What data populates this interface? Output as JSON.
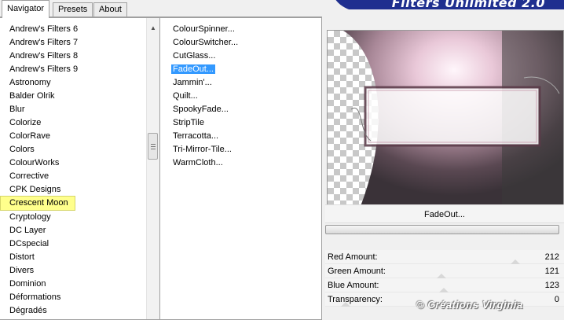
{
  "banner": {
    "text": "Filters Unlimited 2.0"
  },
  "tabs": [
    {
      "label": "Navigator"
    },
    {
      "label": "Presets"
    },
    {
      "label": "About"
    }
  ],
  "categories": {
    "items": [
      "Andrew's Filters 6",
      "Andrew's Filters 7",
      "Andrew's Filters 8",
      "Andrew's Filters 9",
      "Astronomy",
      "Balder Olrik",
      "Blur",
      "Colorize",
      "ColorRave",
      "Colors",
      "ColourWorks",
      "Corrective",
      "CPK Designs",
      "Crescent Moon",
      "Cryptology",
      "DC Layer",
      "DCspecial",
      "Distort",
      "Divers",
      "Dominion",
      "Déformations",
      "Dégradés"
    ],
    "highlighted": "Crescent Moon"
  },
  "filters": {
    "items": [
      "ColourSpinner...",
      "ColourSwitcher...",
      "CutGlass...",
      "FadeOut...",
      "Jammin'...",
      "Quilt...",
      "SpookyFade...",
      "StripTile",
      "Terracotta...",
      "Tri-Mirror-Tile...",
      "WarmCloth..."
    ],
    "selected": "FadeOut..."
  },
  "preview": {
    "filter_name": "FadeOut..."
  },
  "params": [
    {
      "label": "Red Amount:",
      "value": "212",
      "level": 0.83
    },
    {
      "label": "Green Amount:",
      "value": "121",
      "level": 0.47
    },
    {
      "label": "Blue Amount:",
      "value": "123",
      "level": 0.48
    },
    {
      "label": "Transparency:",
      "value": "0",
      "level": 0.0
    }
  ],
  "watermark": {
    "text": "© Créations Virginia"
  },
  "colors": {
    "selection": "#3399ff",
    "highlight": "#ffff8c",
    "banner": "#1f2f8f"
  },
  "icons": {
    "scroll_up": "scroll-up-arrow-icon"
  }
}
